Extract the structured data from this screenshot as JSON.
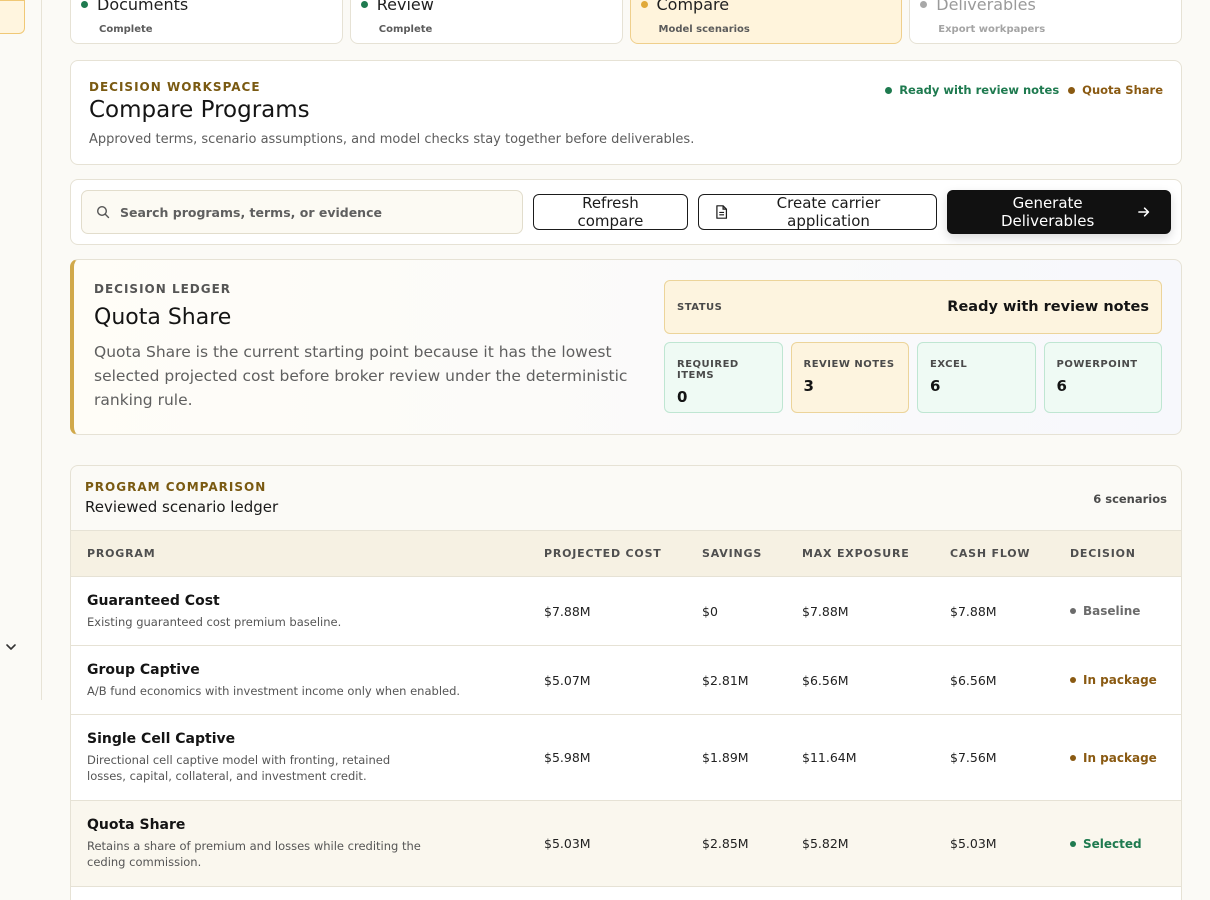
{
  "colors": {
    "accent_gold": "#d1a94b",
    "green": "#1e7a4f",
    "brown": "#8a5a12",
    "gray": "#6b6b6b"
  },
  "steps": [
    {
      "title": "Documents",
      "sub": "Complete",
      "state": "complete"
    },
    {
      "title": "Review",
      "sub": "Complete",
      "state": "complete"
    },
    {
      "title": "Compare",
      "sub": "Model scenarios",
      "state": "active"
    },
    {
      "title": "Deliverables",
      "sub": "Export workpapers",
      "state": "pending"
    }
  ],
  "workspace": {
    "eyebrow": "DECISION WORKSPACE",
    "title": "Compare Programs",
    "description": "Approved terms, scenario assumptions, and model checks stay together before deliverables.",
    "badge_status": "Ready with review notes",
    "badge_program": "Quota Share"
  },
  "toolbar": {
    "search_placeholder": "Search programs, terms, or evidence",
    "refresh_label": "Refresh compare",
    "carrier_label": "Create carrier application",
    "generate_label": "Generate Deliverables"
  },
  "ledger": {
    "eyebrow": "DECISION LEDGER",
    "title": "Quota Share",
    "description": "Quota Share is the current starting point because it has the lowest selected projected cost before broker review under the deterministic ranking rule.",
    "status_label": "STATUS",
    "status_value": "Ready with review notes",
    "metrics": [
      {
        "label": "REQUIRED ITEMS",
        "value": "0"
      },
      {
        "label": "REVIEW NOTES",
        "value": "3"
      },
      {
        "label": "EXCEL",
        "value": "6"
      },
      {
        "label": "POWERPOINT",
        "value": "6"
      }
    ]
  },
  "comparison": {
    "eyebrow": "PROGRAM COMPARISON",
    "subtitle": "Reviewed scenario ledger",
    "count": "6 scenarios",
    "headers": [
      "PROGRAM",
      "PROJECTED COST",
      "SAVINGS",
      "MAX EXPOSURE",
      "CASH FLOW",
      "DECISION"
    ],
    "rows": [
      {
        "name": "Guaranteed Cost",
        "desc": "Existing guaranteed cost premium baseline.",
        "cost": "$7.88M",
        "savings": "$0",
        "exposure": "$7.88M",
        "cash": "$7.88M",
        "decision": "Baseline",
        "decision_color": "#6b6b6b"
      },
      {
        "name": "Group Captive",
        "desc": "A/B fund economics with investment income only when enabled.",
        "cost": "$5.07M",
        "savings": "$2.81M",
        "exposure": "$6.56M",
        "cash": "$6.56M",
        "decision": "In package",
        "decision_color": "#8a5a12"
      },
      {
        "name": "Single Cell Captive",
        "desc": "Directional cell captive model with fronting, retained losses, capital, collateral, and investment credit.",
        "cost": "$5.98M",
        "savings": "$1.89M",
        "exposure": "$11.64M",
        "cash": "$7.56M",
        "decision": "In package",
        "decision_color": "#8a5a12"
      },
      {
        "name": "Quota Share",
        "desc": "Retains a share of premium and losses while crediting the ceding commission.",
        "cost": "$5.03M",
        "savings": "$2.85M",
        "exposure": "$5.82M",
        "cash": "$5.03M",
        "decision": "Selected",
        "decision_color": "#1e7a4f"
      }
    ]
  }
}
